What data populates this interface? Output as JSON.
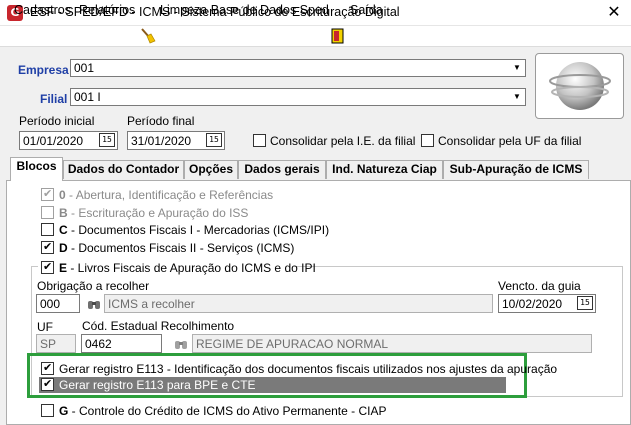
{
  "window": {
    "title": "ESF - SPED/EFD - ICMS - Sistema Público de Escrituração Digital",
    "close_glyph": "✕",
    "app_icon_letter": "G"
  },
  "menu": {
    "cadastros": "Cadastros",
    "relatorios": "Relatórios",
    "limpeza": "Limpeza Base de Dados Sped",
    "saida": "Saída"
  },
  "empresa": {
    "label": "Empresa",
    "value": "001"
  },
  "filial": {
    "label": "Filial",
    "value": "001 I"
  },
  "periodo_inicial": {
    "label": "Período inicial",
    "value": "01/01/2020"
  },
  "periodo_final": {
    "label": "Período final",
    "value": "31/01/2020"
  },
  "calendar_glyph": "15",
  "consolidar_ie": {
    "label": "Consolidar pela I.E. da filial",
    "checked": false
  },
  "consolidar_uf": {
    "label": "Consolidar pela UF da filial",
    "checked": false
  },
  "tabs": [
    "Blocos",
    "Dados do Contador",
    "Opções",
    "Dados gerais",
    "Ind. Natureza Ciap",
    "Sub-Apuração de ICMS"
  ],
  "blocos": {
    "b0": {
      "code": "0",
      "text": " - Abertura, Identificação e Referências"
    },
    "bb": {
      "code": "B",
      "text": " - Escrituração e Apuração do ISS"
    },
    "bc": {
      "code": "C",
      "text": " - Documentos Fiscais I - Mercadorias (ICMS/IPI)"
    },
    "bd": {
      "code": "D",
      "text": " - Documentos Fiscais II - Serviços (ICMS)"
    },
    "be": {
      "code": "E",
      "text": " - Livros Fiscais de Apuração do ICMS e do IPI"
    },
    "bg": {
      "code": "G",
      "text": " - Controle do Crédito de ICMS do Ativo Permanente - CIAP"
    }
  },
  "obrigacao": {
    "label": "Obrigação a recolher",
    "code": "000",
    "desc": "ICMS a recolher"
  },
  "vencto": {
    "label": "Vencto. da guia",
    "value": "10/02/2020"
  },
  "uf": {
    "label": "UF",
    "value": "SP"
  },
  "cod_estadual": {
    "label": "Cód. Estadual Recolhimento",
    "code": "0462",
    "desc": "REGIME DE APURACAO NORMAL"
  },
  "e113": {
    "label": "Gerar registro E113 - Identificação dos documentos fiscais utilizados nos ajustes da apuração",
    "checked": true
  },
  "e113_bpe": {
    "label": "Gerar registro E113 para BPE e CTE",
    "checked": true
  },
  "colors": {
    "accent_blue": "#1f3fa6",
    "highlight_green": "#2d9e3c",
    "app_red": "#c8262d"
  }
}
